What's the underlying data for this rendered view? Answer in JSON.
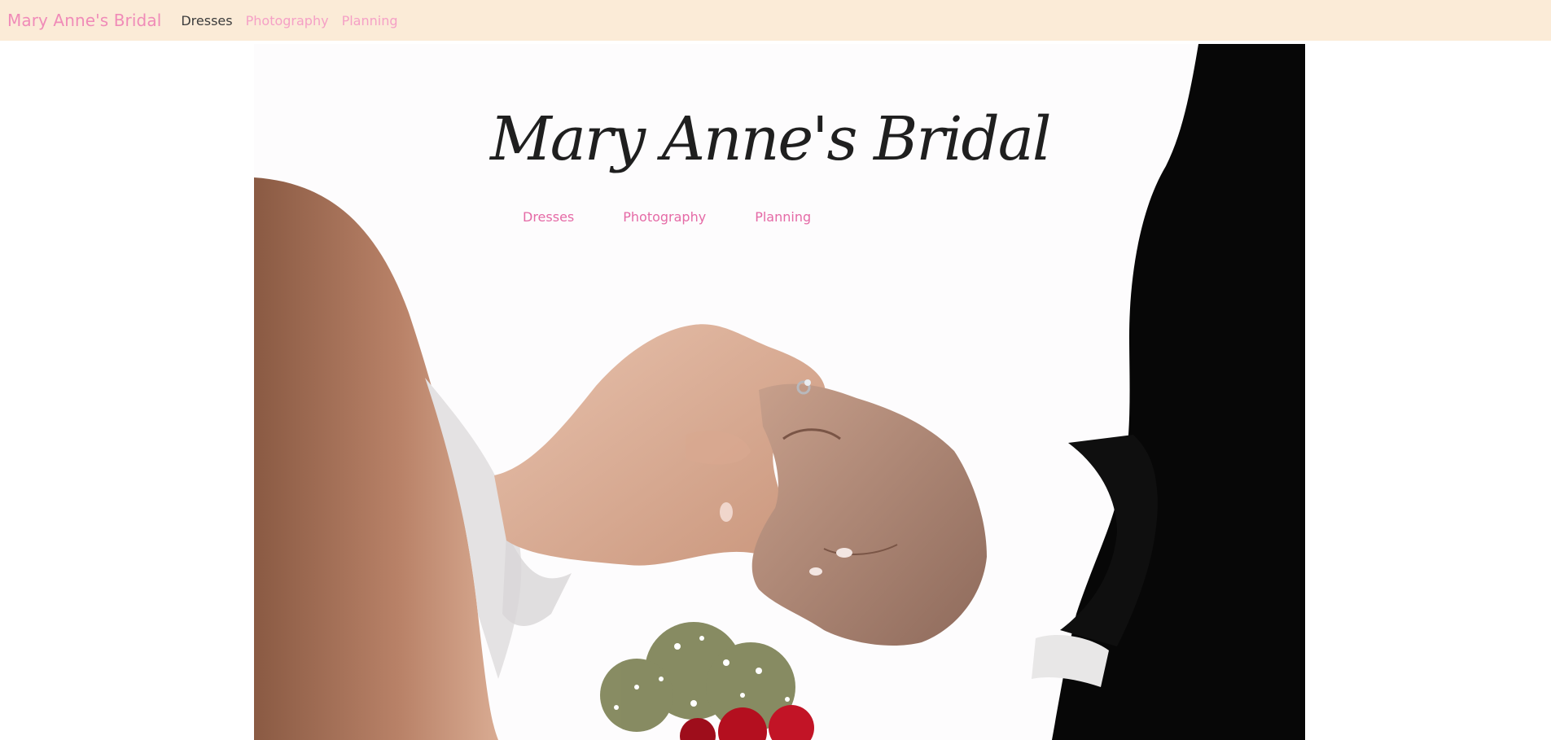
{
  "navbar": {
    "brand": "Mary Anne's Bridal",
    "links": [
      {
        "label": "Dresses",
        "active": true
      },
      {
        "label": "Photography",
        "active": false
      },
      {
        "label": "Planning",
        "active": false
      }
    ],
    "background": "#fbebd7",
    "brand_color": "#f08bb8"
  },
  "hero": {
    "logo_text": "Mary Anne's Bridal",
    "links": [
      {
        "label": "Dresses"
      },
      {
        "label": "Photography"
      },
      {
        "label": "Planning"
      }
    ],
    "link_color": "#e56aa6"
  }
}
